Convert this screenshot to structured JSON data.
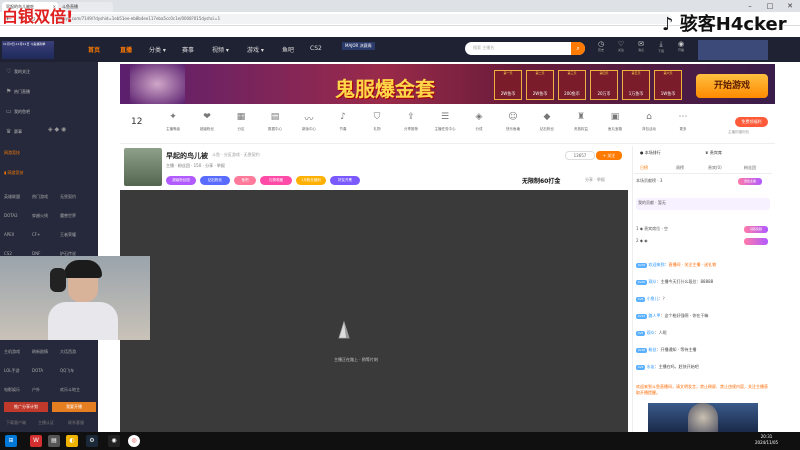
{
  "watermark_left": "白银双倍!",
  "watermark_right": "骇客H4cker",
  "browser": {
    "tab1_title": "早起的鸟儿被吃",
    "tab2_title": "斗鱼直播",
    "url": "douyu.com/7149/?dyshid=1eb51ee-eb8b4ee117eba5cc0c1e/0008?015dyshci=1"
  },
  "header": {
    "promo_small": "11月3日-11月11日 斗鱼福利季",
    "nav": [
      "首页",
      "直播",
      "分类",
      "赛事",
      "视频",
      "游戏",
      "鱼吧",
      "CS2"
    ],
    "search_placeholder": "搜索 主播名",
    "icons": [
      {
        "name": "history-icon",
        "label": "历史"
      },
      {
        "name": "follow-icon",
        "label": "关注"
      },
      {
        "name": "message-icon",
        "label": "消息"
      },
      {
        "name": "download-icon",
        "label": "下载"
      },
      {
        "name": "live-icon",
        "label": "开播"
      }
    ],
    "promo_event": "MAJOR 决赛周"
  },
  "sidebar": {
    "items": [
      {
        "icon": "heart-icon",
        "label": "我的关注"
      },
      {
        "icon": "flag-icon",
        "label": "热门直播"
      },
      {
        "icon": "tv-icon",
        "label": "我的鱼吧"
      },
      {
        "icon": "trophy-icon",
        "label": "赛事"
      }
    ],
    "section1": "网游竞技",
    "grid1": [
      "英雄联盟",
      "热门游戏",
      "无畏契约",
      "DOTA2",
      "穿越火线",
      "魔兽世界",
      "APEX",
      "CF+",
      "王者荣耀",
      "CS2",
      "DNF",
      "炉石传说",
      "魔兽争霸",
      "原神",
      "崩坏星穹"
    ],
    "section2": "单机热游",
    "grid2": [
      "主机游戏",
      "刷新剧情",
      "大话西游",
      "LOL手游",
      "DOTA",
      "QQ飞车",
      "电影娱乐",
      "户外",
      "欢乐斗地主",
      "星际",
      "二次元",
      "娱乐天地"
    ],
    "btn_left": "推广分享计划",
    "btn_right": "我要开播",
    "footer": [
      "下载客户端",
      "主播认证",
      "联系客服"
    ]
  },
  "ad": {
    "title": "鬼服爆金套",
    "days": [
      {
        "d": "第一天",
        "v": "2W鱼币"
      },
      {
        "d": "第二天",
        "v": "2W鱼币"
      },
      {
        "d": "第三天",
        "v": "200鱼币"
      },
      {
        "d": "第四天",
        "v": "20万币"
      },
      {
        "d": "第五天",
        "v": "1万鱼币"
      },
      {
        "d": "第六天",
        "v": "1W鱼币"
      }
    ],
    "start_button": "开始游戏"
  },
  "categories": {
    "count": "12",
    "items": [
      "主播等级",
      "超级粉丝",
      "分区",
      "数据中心",
      "新版中心",
      "节奏",
      "礼物",
      "分享推荐",
      "主播任务中心",
      "分成",
      "快乐鱼塘",
      "钻石粉丝",
      "贵族权益",
      "鱼丸宝箱",
      "背包活动",
      "更多"
    ],
    "special": "免费领福利",
    "special_sub": "主播的福利包"
  },
  "room": {
    "title": "早起的鸟儿被",
    "meta": "斗鱼 · 分区游戏 · 无畏契约",
    "line2": "主播 · 粉丝团 · 150 · 分享 · 举报",
    "tags": [
      {
        "label": "超级粉丝团",
        "color": "#b05aff"
      },
      {
        "label": "钻石粉丝",
        "color": "#5a6cff"
      },
      {
        "label": "鱼吧",
        "color": "#ff7a9a"
      },
      {
        "label": "礼物收藏",
        "color": "#ff4aa8"
      },
      {
        "label": "1月粉丝福利",
        "color": "#ffb000"
      },
      {
        "label": "好友开黑",
        "color": "#7a5aff"
      }
    ],
    "follow_count": "13657",
    "follow_label": "关注",
    "extra": "无限制60打金",
    "actions": "分享 · 举报"
  },
  "player": {
    "loading_text": "主播正在路上 · 稍等片刻"
  },
  "right_panel": {
    "header": "本场排行",
    "header2": "贵宾席",
    "tabs": [
      "日榜",
      "周榜",
      "贵宾(0)",
      "粉丝团"
    ],
    "rank_rows": [
      {
        "label": "本场贡献榜 · 3",
        "badge": "送给主播"
      },
      {
        "label": "我的贡献 · 暂无",
        "badge": ""
      },
      {
        "label": "贵宾席位 · 空",
        "badge": "领取奖励"
      }
    ],
    "chat": [
      {
        "lvl": "LV15",
        "user": "欢迎来到",
        "text": "直播间 · 关注主播 · 送礼物",
        "color": "orange"
      },
      {
        "lvl": "LV20",
        "user": "观众",
        "text": "主播今天打什么段位：88888"
      },
      {
        "lvl": "LV8",
        "user": "小鱼儿",
        "text": "？"
      },
      {
        "lvl": "LV12",
        "user": "路人甲",
        "text": "这个枪好强啊 · 你在干嘛"
      },
      {
        "lvl": "LV5",
        "user": "观众",
        "text": "人呢"
      },
      {
        "lvl": "LV18",
        "user": "粉丝",
        "text": "开播通知 · 等待主播"
      },
      {
        "lvl": "LV9",
        "user": "水友",
        "text": "主播在吗，赶快开始吧"
      }
    ],
    "notice": "欢迎来到斗鱼直播间，请文明发言，禁止刷屏、禁止违规内容，关注主播获取开播提醒。"
  },
  "taskbar": {
    "time": "20:31",
    "date": "2024/11/05"
  }
}
